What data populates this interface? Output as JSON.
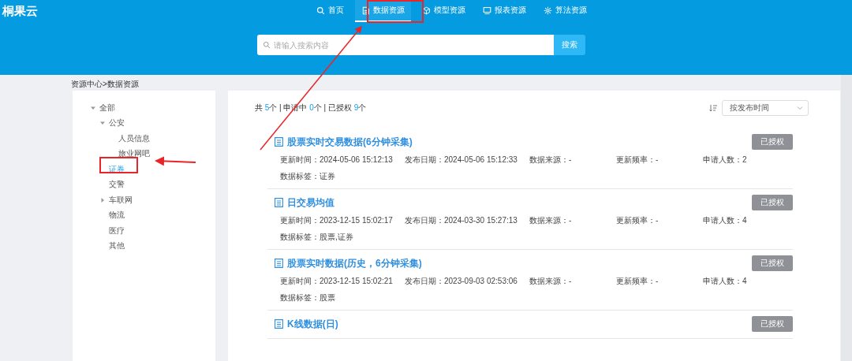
{
  "header": {
    "logo": "桐果云",
    "nav": [
      {
        "label": "首页",
        "selected": false
      },
      {
        "label": "数据资源",
        "selected": true
      },
      {
        "label": "模型资源",
        "selected": false
      },
      {
        "label": "报表资源",
        "selected": false
      },
      {
        "label": "算法资源",
        "selected": false
      }
    ],
    "search": {
      "placeholder": "请输入搜索内容",
      "button": "搜索"
    }
  },
  "breadcrumb": "资源中心>数据资源",
  "sidebar": {
    "tree": [
      {
        "label": "全部",
        "expanded": true,
        "selected": false,
        "children": [
          {
            "label": "公安",
            "expanded": true,
            "selected": false,
            "children": [
              {
                "label": "人员信息",
                "selected": false
              },
              {
                "label": "旅业网吧",
                "selected": false
              }
            ]
          },
          {
            "label": "证券",
            "selected": true
          },
          {
            "label": "交警",
            "selected": false
          },
          {
            "label": "车联网",
            "expanded": false,
            "selected": false
          },
          {
            "label": "物流",
            "selected": false
          },
          {
            "label": "医疗",
            "selected": false
          },
          {
            "label": "其他",
            "selected": false
          }
        ]
      }
    ]
  },
  "summary": [
    {
      "prefix": "共 ",
      "count": "5",
      "suffix": "个"
    },
    {
      "prefix": " | 申请中 ",
      "count": "0",
      "suffix": "个"
    },
    {
      "prefix": " | 已授权 ",
      "count": "9",
      "suffix": "个"
    }
  ],
  "sort": {
    "value": "按发布时间"
  },
  "resources": [
    {
      "title": "股票实时交易数据(6分钟采集)",
      "meta": [
        "更新时间：2024-05-06 15:12:13",
        "发布日期：2024-05-06 15:12:33",
        "数据来源：-",
        "更新频率：-",
        "申请人数：2"
      ],
      "tags": "数据标签：证券",
      "button": "已授权"
    },
    {
      "title": "日交易均值",
      "meta": [
        "更新时间：2023-12-15 15:02:17",
        "发布日期：2024-03-30 15:27:13",
        "数据来源：-",
        "更新频率：-",
        "申请人数：4"
      ],
      "tags": "数据标签：股票,证券",
      "button": "已授权"
    },
    {
      "title": "股票实时数据(历史，6分钟采集)",
      "meta": [
        "更新时间：2023-12-15 15:02:21",
        "发布日期：2023-09-03 02:53:06",
        "数据来源：-",
        "更新频率：-",
        "申请人数：4"
      ],
      "tags": "数据标签：股票",
      "button": "已授权"
    },
    {
      "title": "K线数据(日)",
      "button": "已授权"
    }
  ]
}
